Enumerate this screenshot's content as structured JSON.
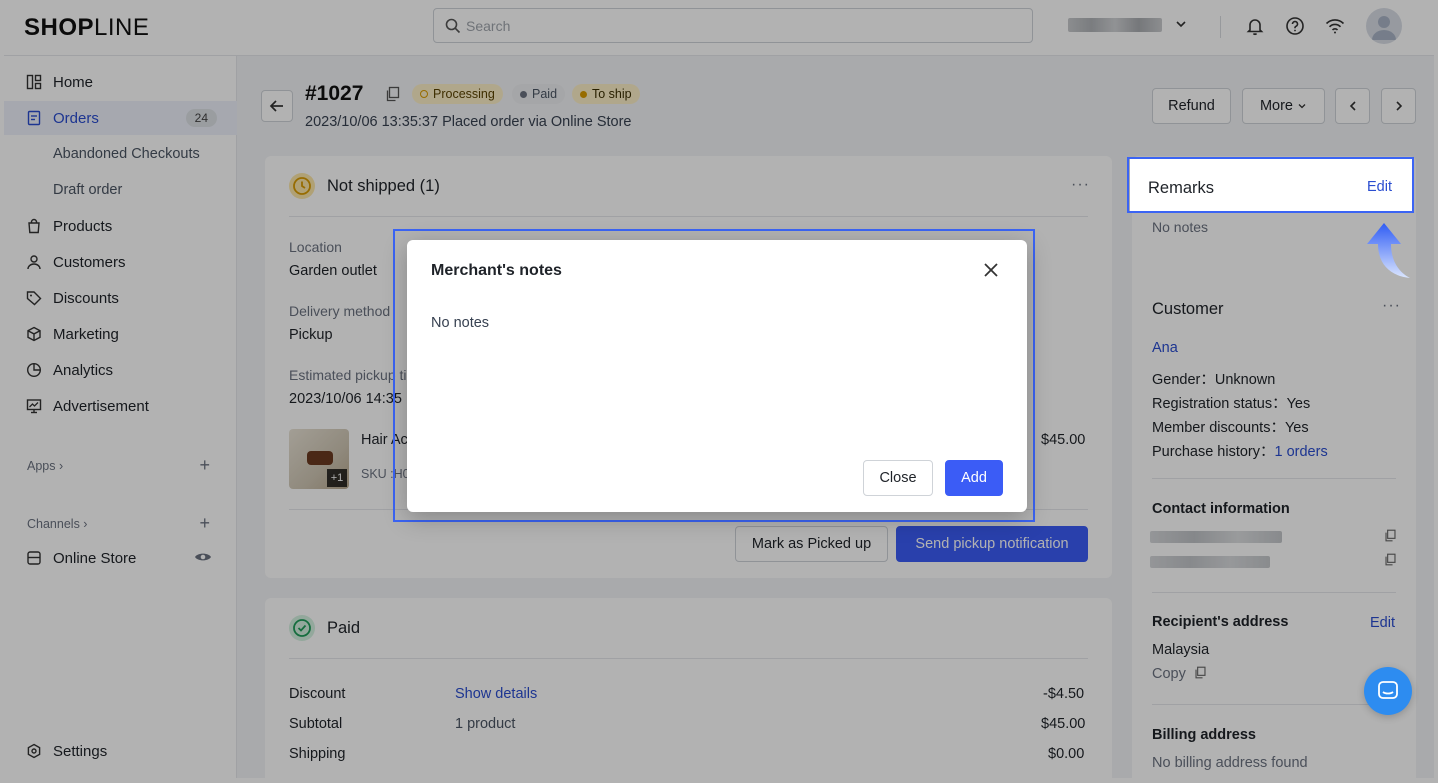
{
  "brand": {
    "logo_bold": "SHOP",
    "logo_thin": "LINE"
  },
  "search": {
    "placeholder": "Search"
  },
  "colors": {
    "accent": "#2a4dd0",
    "primary_button": "#3b5cf6",
    "highlight": "#3b64f4",
    "chat": "#2d8cf0"
  },
  "sidebar": {
    "items": [
      {
        "label": "Home",
        "icon": "home-icon"
      },
      {
        "label": "Orders",
        "icon": "orders-icon",
        "count": "24"
      },
      {
        "label": "Abandoned Checkouts"
      },
      {
        "label": "Draft order"
      },
      {
        "label": "Products",
        "icon": "bag-icon"
      },
      {
        "label": "Customers",
        "icon": "person-icon"
      },
      {
        "label": "Discounts",
        "icon": "tag-icon"
      },
      {
        "label": "Marketing",
        "icon": "box-icon"
      },
      {
        "label": "Analytics",
        "icon": "pie-icon"
      },
      {
        "label": "Advertisement",
        "icon": "chart-screen-icon"
      }
    ],
    "apps_label": "Apps",
    "channels_label": "Channels",
    "online_store": "Online Store",
    "settings": "Settings"
  },
  "order": {
    "id": "#1027",
    "tags": {
      "processing": "Processing",
      "paid": "Paid",
      "to_ship": "To ship"
    },
    "subtitle": "2023/10/06 13:35:37 Placed order via Online Store"
  },
  "actions": {
    "refund": "Refund",
    "more": "More"
  },
  "shipment": {
    "title": "Not shipped (1)",
    "location_label": "Location",
    "location_value": "Garden outlet",
    "delivery_label": "Delivery method",
    "delivery_value": "Pickup",
    "pickup_label": "Estimated pickup ti",
    "pickup_value": "2023/10/06 14:35",
    "product_name": "Hair Acc",
    "product_sku": "SKU :H00",
    "product_qty_badge": "+1",
    "product_price": "$45.00",
    "mark_picked": "Mark as Picked up",
    "send_notification": "Send pickup notification"
  },
  "payment": {
    "title": "Paid",
    "rows": [
      {
        "label": "Discount",
        "detail": "Show details",
        "amount": "-$4.50"
      },
      {
        "label": "Subtotal",
        "detail": "1 product",
        "amount": "$45.00"
      },
      {
        "label": "Shipping",
        "detail": "",
        "amount": "$0.00"
      }
    ]
  },
  "remarks": {
    "title": "Remarks",
    "edit": "Edit",
    "empty": "No notes"
  },
  "customer": {
    "title": "Customer",
    "name": "Ana",
    "gender": "Gender：Unknown",
    "registration": "Registration status：Yes",
    "member_discounts": "Member discounts：Yes",
    "purchase_history_label": "Purchase history：",
    "purchase_history_value": "1 orders",
    "contact_title": "Contact information",
    "recipient_title": "Recipient's address",
    "recipient_edit": "Edit",
    "recipient_country": "Malaysia",
    "copy": "Copy",
    "billing_title": "Billing address",
    "billing_empty": "No billing address found"
  },
  "modal": {
    "title": "Merchant's notes",
    "body": "No notes",
    "close": "Close",
    "add": "Add"
  }
}
